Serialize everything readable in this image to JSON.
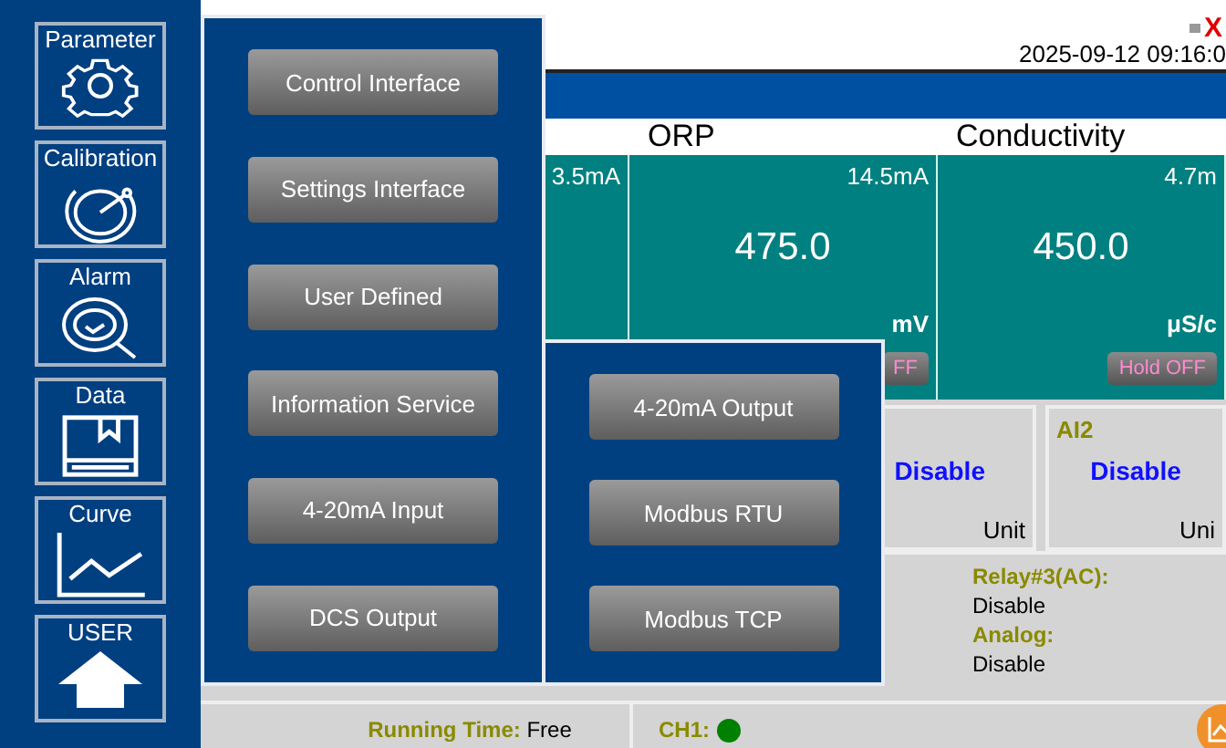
{
  "sidebar": [
    {
      "label": "Parameter",
      "kind": "gear"
    },
    {
      "label": "Calibration",
      "kind": "dial"
    },
    {
      "label": "Alarm",
      "kind": "magnifier"
    },
    {
      "label": "Data",
      "kind": "box"
    },
    {
      "label": "Curve",
      "kind": "curve"
    },
    {
      "label": "USER",
      "kind": "home"
    }
  ],
  "header": {
    "close_glyph": "X",
    "datetime": "2025-09-12 09:16:0"
  },
  "channels": [
    {
      "current": "3.5mA"
    },
    {
      "name": "ORP",
      "current": "14.5mA",
      "value": "475.0",
      "unit": "mV",
      "hold": "FF"
    },
    {
      "name": "Conductivity",
      "current": "4.7m",
      "value": "450.0",
      "unit": "μS/c",
      "hold": "Hold OFF"
    }
  ],
  "inputs": [
    {
      "value": "Disable",
      "unit": "Unit"
    },
    {
      "label": "AI2",
      "value": "Disable",
      "unit": "Uni"
    }
  ],
  "outputs": [
    {
      "label": "Relay#3(AC):",
      "value": "Disable"
    },
    {
      "label": "Analog:",
      "value": "Disable"
    }
  ],
  "status_bar": {
    "running_label": "Running Time:",
    "running_value": "Free",
    "channel": {
      "label": "CH1:",
      "color": "#008000"
    }
  },
  "menu": [
    "Control Interface",
    "Settings Interface",
    "User Defined",
    "Information Service",
    "4-20mA Input",
    "DCS Output"
  ],
  "submenu": [
    "4-20mA Output",
    "Modbus RTU",
    "Modbus TCP"
  ]
}
